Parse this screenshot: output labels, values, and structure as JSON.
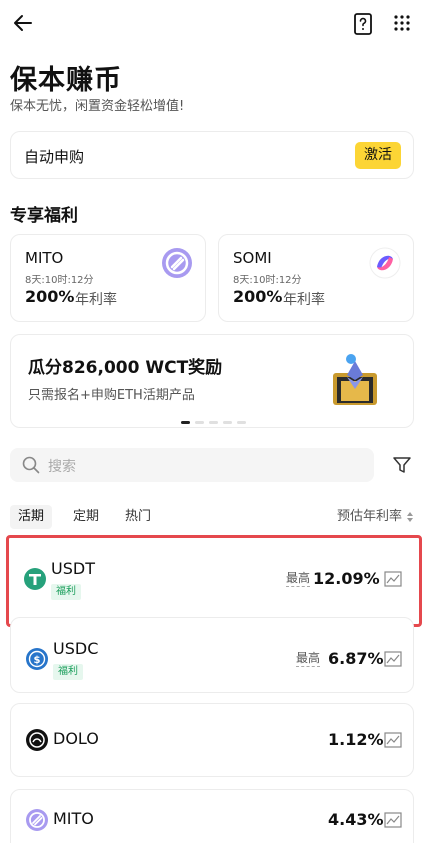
{
  "header": {
    "back_icon": "arrow-left-icon",
    "help_icon": "help-book-icon",
    "apps_icon": "grid-dots-icon"
  },
  "page": {
    "title": "保本赚币",
    "subtitle": "保本无忧，闲置资金轻松增值!"
  },
  "auto_subscribe": {
    "label": "自动申购",
    "button": "激活",
    "button_color": "#fcd535"
  },
  "exclusive": {
    "title": "专享福利",
    "cards": [
      {
        "name": "MITO",
        "time": "8天:10时:12分",
        "rate": "200%",
        "rate_label": "年利率",
        "icon": "mito-coin-icon"
      },
      {
        "name": "SOMI",
        "time": "8天:10时:12分",
        "rate": "200%",
        "rate_label": "年利率",
        "icon": "somi-coin-icon"
      }
    ]
  },
  "banner": {
    "title": "瓜分826,000 WCT奖励",
    "subtitle": "只需报名+申购ETH活期产品",
    "art_icon": "eth-treasure-icon"
  },
  "search": {
    "placeholder": "搜索"
  },
  "tabs": {
    "items": [
      "活期",
      "定期",
      "热门"
    ],
    "active": "活期",
    "sort_label": "预估年利率"
  },
  "products": [
    {
      "name": "USDT",
      "badge": "福利",
      "max_label": "最高",
      "apr": "12.09%",
      "icon": "usdt-icon"
    },
    {
      "name": "USDC",
      "badge": "福利",
      "max_label": "最高",
      "apr": "6.87%",
      "icon": "usdc-icon"
    },
    {
      "name": "DOLO",
      "badge": "",
      "max_label": "",
      "apr": "1.12%",
      "icon": "dolo-icon"
    },
    {
      "name": "MITO",
      "badge": "",
      "max_label": "",
      "apr": "4.43%",
      "icon": "mito-icon"
    }
  ],
  "colors": {
    "accent": "#fcd535",
    "badge_green": "#1a9e5b",
    "selection_red": "#e5484d"
  }
}
